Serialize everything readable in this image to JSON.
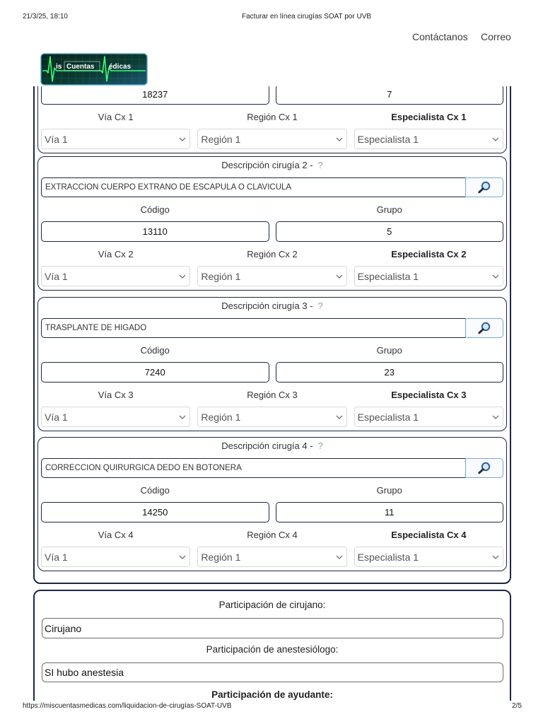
{
  "print_header": {
    "datetime": "21/3/25, 18:10",
    "title": "Facturar en línea cirugías SOAT por UVB"
  },
  "nav": {
    "contact": "Contáctanos",
    "mail": "Correo"
  },
  "logo": {
    "part_1": "is",
    "part_2": "Cuentas",
    "part_3": "édicas"
  },
  "colors": {
    "panel_border": "#1d2745",
    "select_border": "#d9d9d9",
    "search_button_border": "#7aa7d6",
    "help_text": "#9a9a9a",
    "logo_ecg_line": "#3dff72"
  },
  "surgeries": [
    {
      "code": "18237",
      "group": "7",
      "via_label": "Vía Cx 1",
      "region_label": "Región Cx 1",
      "specialist_label": "Especialista Cx 1",
      "via": "Vía 1",
      "region": "Región 1",
      "specialist": "Especialista 1"
    },
    {
      "title": "Descripción cirugía 2 -",
      "help": "?",
      "description": "EXTRACCION CUERPO EXTRAÑO DE ESCAPULA O CLAVICULA",
      "code_label": "Código",
      "group_label": "Grupo",
      "code": "13110",
      "group": "5",
      "via_label": "Vía Cx 2",
      "region_label": "Región Cx 2",
      "specialist_label": "Especialista Cx 2",
      "via": "Vía 1",
      "region": "Región 1",
      "specialist": "Especialista 1"
    },
    {
      "title": "Descripción cirugía 3 -",
      "help": "?",
      "description": "TRASPLANTE DE HIGADO",
      "code_label": "Código",
      "group_label": "Grupo",
      "code": "7240",
      "group": "23",
      "via_label": "Vía Cx 3",
      "region_label": "Región Cx 3",
      "specialist_label": "Especialista Cx 3",
      "via": "Vía 1",
      "region": "Región 1",
      "specialist": "Especialista 1"
    },
    {
      "title": "Descripción cirugía 4 -",
      "help": "?",
      "description": "CORRECCION QUIRURGICA DEDO EN BOTONERA",
      "code_label": "Código",
      "group_label": "Grupo",
      "code": "14250",
      "group": "11",
      "via_label": "Vía Cx 4",
      "region_label": "Región Cx 4",
      "specialist_label": "Especialista Cx 4",
      "via": "Vía 1",
      "region": "Región 1",
      "specialist": "Especialista 1"
    }
  ],
  "participation": {
    "surgeon_label": "Participación de cirujano:",
    "surgeon_value": "Cirujano",
    "anesthesiologist_label": "Participación de anestesiólogo:",
    "anesthesiologist_value": "SI hubo anestesia",
    "assistant_label": "Participación de ayudante:"
  },
  "print_footer": {
    "url": "https://miscuentasmedicas.com/liquidacion-de-cirugías-SOAT-UVB",
    "page": "2/5"
  }
}
